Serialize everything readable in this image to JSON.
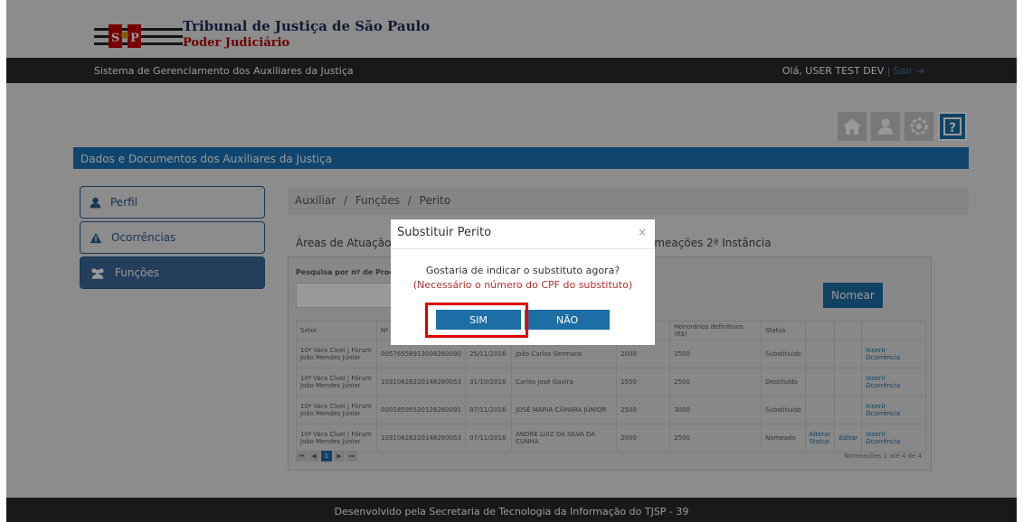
{
  "header": {
    "title": "Tribunal de Justiça de São Paulo",
    "subtitle": "Poder Judiciário",
    "logo_letters": "S P"
  },
  "topbar": {
    "system_name": "Sistema de Gerenciamento dos Auxiliares da Justiça",
    "greeting": "Olá, USER TEST DEV",
    "separator": "|",
    "logout": "Sair"
  },
  "toolbar_icons": [
    "home-icon",
    "user-icon",
    "gear-icon",
    "help-icon"
  ],
  "section_title": "Dados e Documentos dos Auxiliares da Justiça",
  "sidebar": {
    "items": [
      {
        "label": "Perfil",
        "icon": "user-icon"
      },
      {
        "label": "Ocorrências",
        "icon": "warning-icon"
      },
      {
        "label": "Funções",
        "icon": "group-icon"
      }
    ]
  },
  "breadcrumb": {
    "items": [
      "Auxiliar",
      "Funções",
      "Perito"
    ],
    "separator": "/"
  },
  "tabs": {
    "tab1": "Áreas de Atuação",
    "tab2": "omeações 2ª Instância"
  },
  "search": {
    "label": "Pesquisa por nº de Proces"
  },
  "nomear_button": "Nomear",
  "table": {
    "headers": [
      "Setor",
      "Nº",
      "",
      "",
      "",
      "orios (R$)",
      "Honorários definitivos (R$)",
      "Status",
      "",
      "",
      ""
    ],
    "rows": [
      {
        "setor": "10ª Vara Cível | Fórum João Mendes Júnior",
        "processo": "00576558913008260090",
        "data": "25/11/2016",
        "perito": "João Carlos Germano",
        "prov": "2000",
        "def": "2500",
        "status": "Substituído",
        "alterar": "",
        "editar": "",
        "inserir": "Inserir Ocorrência"
      },
      {
        "setor": "10ª Vara Cível | Fórum João Mendes Júnior",
        "processo": "10310828220148260053",
        "data": "31/10/2016",
        "perito": "Carlos José Gavira",
        "prov": "1500",
        "def": "2500",
        "status": "Destituído",
        "alterar": "",
        "editar": "",
        "inserir": "Inserir Ocorrência"
      },
      {
        "setor": "10ª Vara Cível | Fórum João Mendes Júnior",
        "processo": "00018595520128260091",
        "data": "07/11/2016",
        "perito": "JOSÉ MARIA CÂMARA JÚNIOR",
        "prov": "2500",
        "def": "3000",
        "status": "Substituído",
        "alterar": "",
        "editar": "",
        "inserir": "Inserir Ocorrência"
      },
      {
        "setor": "10ª Vara Cível | Fórum João Mendes Júnior",
        "processo": "10310828220148260053",
        "data": "07/11/2016",
        "perito": "ANDRÉ LUIZ DA SILVA DA CUNHA",
        "prov": "2000",
        "def": "2500",
        "status": "Nomeado",
        "alterar": "Alterar Status",
        "editar": "Editar",
        "inserir": "Inserir Ocorrência"
      }
    ]
  },
  "pager": {
    "first": "⏮",
    "prev": "◀",
    "current": "1",
    "next": "▶",
    "last": "⏭",
    "info": "Nomeações 1 até 4 de 4"
  },
  "footer": "Desenvolvido pela Secretaria de Tecnologia da Informação do TJSP - 39",
  "modal": {
    "title": "Substituir Perito",
    "close": "×",
    "message": "Gostaria de indicar o substituto agora?",
    "note": "(Necessário o número do CPF do substituto)",
    "yes": "SIM",
    "no": "NÃO"
  },
  "colors": {
    "primary": "#1c6ea4",
    "highlight": "#e00000",
    "dark_bar": "#2b2b2b",
    "accent_red": "#b80000"
  }
}
